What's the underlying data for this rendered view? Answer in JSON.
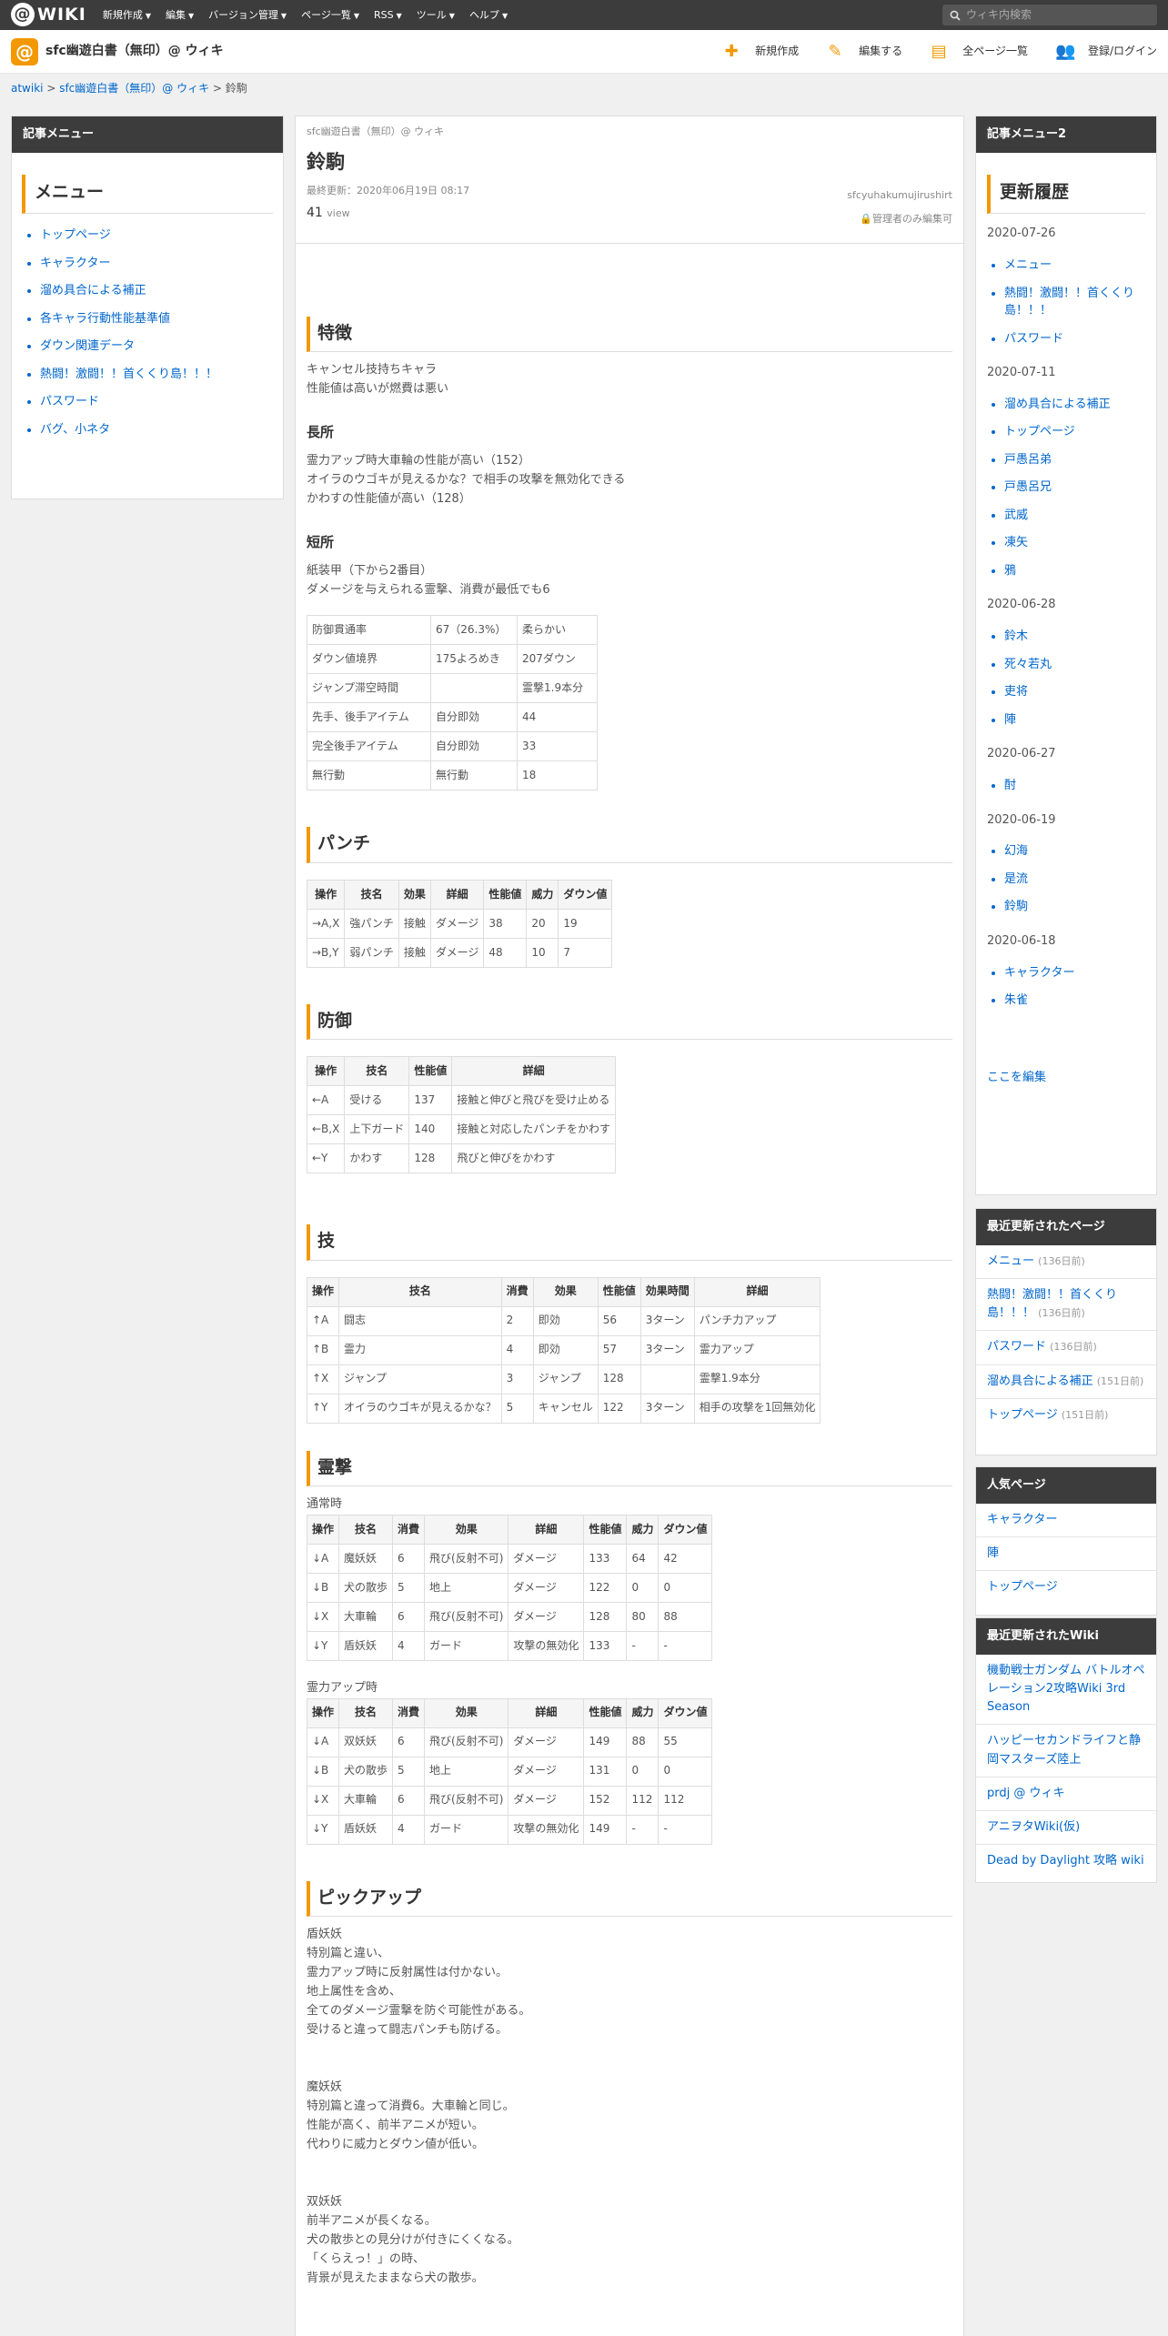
{
  "topbar": {
    "logo_text": "WIKI",
    "nav": [
      "新規作成",
      "編集",
      "バージョン管理",
      "ページ一覧",
      "RSS",
      "ツール",
      "ヘルプ"
    ],
    "search_placeholder": "ウィキ内検索"
  },
  "site": {
    "name": "sfc幽遊白書（無印）@ ウィキ",
    "nav": [
      {
        "icon": "plus-icon",
        "label": "新規作成"
      },
      {
        "icon": "pencil-icon",
        "label": "編集する"
      },
      {
        "icon": "document-icon",
        "label": "全ページ一覧"
      },
      {
        "icon": "user-plus-icon",
        "label": "登録/ログイン"
      }
    ]
  },
  "breadcrumb": [
    "atwiki",
    "sfc幽遊白書（無印）@ ウィキ",
    "鈴駒"
  ],
  "left": {
    "header": "記事メニュー",
    "menu_title": "メニュー",
    "items": [
      "トップページ",
      "キャラクター",
      "溜め具合による補正",
      "各キャラ行動性能基準値",
      "ダウン関連データ",
      "熱闘！激闘！！首くくり島！！！",
      "パスワード",
      "バグ、小ネタ"
    ]
  },
  "page": {
    "site": "sfc幽遊白書（無印）@ ウィキ",
    "title": "鈴駒",
    "updated": "最終更新：2020年06月19日 08:17",
    "author": "sfcyuhakumujirushirt",
    "views": "41",
    "views_unit": "view",
    "lock": "管理者のみ編集可"
  },
  "sec_features": {
    "title": "特徴",
    "lines": [
      "キャンセル技持ちキャラ",
      "性能値は高いが燃費は悪い"
    ]
  },
  "sec_pros": {
    "title": "長所",
    "lines": [
      "霊力アップ時大車輪の性能が高い（152）",
      "オイラのウゴキが見えるかな？で相手の攻撃を無効化できる",
      "かわすの性能値が高い（128）"
    ]
  },
  "sec_cons": {
    "title": "短所",
    "lines": [
      "紙装甲（下から2番目）",
      "ダメージを与えられる霊撃、消費が最低でも6"
    ]
  },
  "stats": [
    [
      "防御貫通率",
      "67（26.3%）",
      "柔らかい"
    ],
    [
      "ダウン値境界",
      "175よろめき",
      "207ダウン"
    ],
    [
      "ジャンプ滞空時間",
      "",
      "霊撃1.9本分"
    ],
    [
      "先手、後手アイテム",
      "自分即効",
      "44"
    ],
    [
      "完全後手アイテム",
      "自分即効",
      "33"
    ],
    [
      "無行動",
      "無行動",
      "18"
    ]
  ],
  "punch": {
    "title": "パンチ",
    "headers": [
      "操作",
      "技名",
      "効果",
      "詳細",
      "性能値",
      "威力",
      "ダウン値"
    ],
    "rows": [
      [
        "→A,X",
        "強パンチ",
        "接触",
        "ダメージ",
        "38",
        "20",
        "19"
      ],
      [
        "→B,Y",
        "弱パンチ",
        "接触",
        "ダメージ",
        "48",
        "10",
        "7"
      ]
    ]
  },
  "defense": {
    "title": "防御",
    "headers": [
      "操作",
      "技名",
      "性能値",
      "詳細"
    ],
    "rows": [
      [
        "←A",
        "受ける",
        "137",
        "接触と伸びと飛びを受け止める"
      ],
      [
        "←B,X",
        "上下ガード",
        "140",
        "接触と対応したパンチをかわす"
      ],
      [
        "←Y",
        "かわす",
        "128",
        "飛びと伸びをかわす"
      ]
    ]
  },
  "skills": {
    "title": "技",
    "headers": [
      "操作",
      "技名",
      "消費",
      "効果",
      "性能値",
      "効果時間",
      "詳細"
    ],
    "rows": [
      [
        "↑A",
        "闘志",
        "2",
        "即効",
        "56",
        "3ターン",
        "パンチ力アップ"
      ],
      [
        "↑B",
        "霊力",
        "4",
        "即効",
        "57",
        "3ターン",
        "霊力アップ"
      ],
      [
        "↑X",
        "ジャンプ",
        "3",
        "ジャンプ",
        "128",
        "",
        "霊撃1.9本分"
      ],
      [
        "↑Y",
        "オイラのウゴキが見えるかな？",
        "5",
        "キャンセル",
        "122",
        "3ターン",
        "相手の攻撃を1回無効化"
      ]
    ]
  },
  "reigeki": {
    "title": "霊撃",
    "normal_caption": "通常時",
    "up_caption": "霊力アップ時",
    "headers": [
      "操作",
      "技名",
      "消費",
      "効果",
      "詳細",
      "性能値",
      "威力",
      "ダウン値"
    ],
    "normal": [
      [
        "↓A",
        "魔妖妖",
        "6",
        "飛び(反射不可)",
        "ダメージ",
        "133",
        "64",
        "42"
      ],
      [
        "↓B",
        "犬の散歩",
        "5",
        "地上",
        "ダメージ",
        "122",
        "0",
        "0"
      ],
      [
        "↓X",
        "大車輪",
        "6",
        "飛び(反射不可)",
        "ダメージ",
        "128",
        "80",
        "88"
      ],
      [
        "↓Y",
        "盾妖妖",
        "4",
        "ガード",
        "攻撃の無効化",
        "133",
        "-",
        "-"
      ]
    ],
    "up": [
      [
        "↓A",
        "双妖妖",
        "6",
        "飛び(反射不可)",
        "ダメージ",
        "149",
        "88",
        "55"
      ],
      [
        "↓B",
        "犬の散歩",
        "5",
        "地上",
        "ダメージ",
        "131",
        "0",
        "0"
      ],
      [
        "↓X",
        "大車輪",
        "6",
        "飛び(反射不可)",
        "ダメージ",
        "152",
        "112",
        "112"
      ],
      [
        "↓Y",
        "盾妖妖",
        "4",
        "ガード",
        "攻撃の無効化",
        "149",
        "-",
        "-"
      ]
    ]
  },
  "pickup": {
    "title": "ピックアップ",
    "blocks": [
      [
        "盾妖妖",
        "特別篇と違い、",
        "霊力アップ時に反射属性は付かない。",
        "地上属性を含め、",
        "全てのダメージ霊撃を防ぐ可能性がある。",
        "受けると違って闘志パンチも防げる。"
      ],
      [
        "魔妖妖",
        "特別篇と違って消費6。大車輪と同じ。",
        "性能が高く、前半アニメが短い。",
        "代わりに威力とダウン値が低い。"
      ],
      [
        "双妖妖",
        "前半アニメが長くなる。",
        "犬の散歩との見分けが付きにくくなる。",
        "「くらえっ！」の時、",
        "背景が見えたままなら犬の散歩。"
      ]
    ]
  },
  "right": {
    "header": "記事メニュー2",
    "title": "更新履歴",
    "groups": [
      {
        "date": "2020-07-26",
        "items": [
          "メニュー",
          "熱闘！激闘！！首くくり島！！！",
          "パスワード"
        ]
      },
      {
        "date": "2020-07-11",
        "items": [
          "溜め具合による補正",
          "トップページ",
          "戸愚呂弟",
          "戸愚呂兄",
          "武威",
          "凍矢",
          "鴉"
        ]
      },
      {
        "date": "2020-06-28",
        "items": [
          "鈴木",
          "死々若丸",
          "吏将",
          "陣"
        ]
      },
      {
        "date": "2020-06-27",
        "items": [
          "酎"
        ]
      },
      {
        "date": "2020-06-19",
        "items": [
          "幻海",
          "是流",
          "鈴駒"
        ]
      },
      {
        "date": "2020-06-18",
        "items": [
          "キャラクター",
          "朱雀"
        ]
      }
    ],
    "edit_link": "ここを編集"
  },
  "recent": {
    "header": "最近更新されたページ",
    "items": [
      {
        "name": "メニュー",
        "ago": "(136日前)"
      },
      {
        "name": "熱闘！激闘！！首くくり島！！！",
        "ago": "(136日前)"
      },
      {
        "name": "パスワード",
        "ago": "(136日前)"
      },
      {
        "name": "溜め具合による補正",
        "ago": "(151日前)"
      },
      {
        "name": "トップページ",
        "ago": "(151日前)"
      }
    ]
  },
  "popular": {
    "header": "人気ページ",
    "items": [
      "キャラクター",
      "陣",
      "トップページ"
    ]
  },
  "wikis": {
    "header": "最近更新されたWiki",
    "items": [
      "機動戦士ガンダム バトルオペレーション2攻略Wiki 3rd Season",
      "ハッピーセカンドライフと静岡マスターズ陸上",
      "prdj @ ウィキ",
      "アニヲタWiki(仮)",
      "Dead by Daylight 攻略 wiki"
    ]
  }
}
